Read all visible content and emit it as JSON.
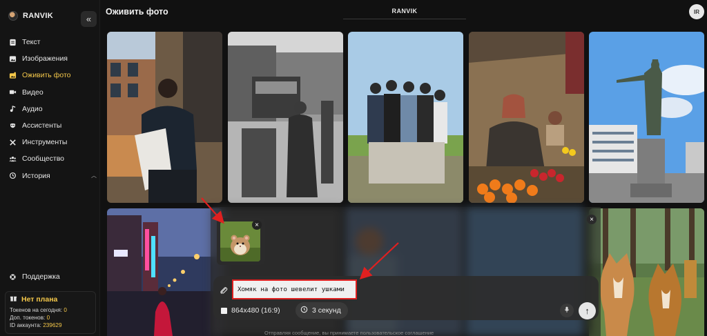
{
  "brand": {
    "name": "RANVIK",
    "collapse_icon": "double-chevron-left-icon"
  },
  "header": {
    "title": "Оживить фото",
    "center_label": "RANVIK",
    "avatar_initials": "IR"
  },
  "sidebar": {
    "items": [
      {
        "label": "Текст",
        "icon": "document-icon",
        "active": false
      },
      {
        "label": "Изображения",
        "icon": "image-icon",
        "active": false
      },
      {
        "label": "Оживить фото",
        "icon": "animate-photo-icon",
        "active": true
      },
      {
        "label": "Видео",
        "icon": "video-camera-icon",
        "active": false
      },
      {
        "label": "Аудио",
        "icon": "music-note-icon",
        "active": false
      },
      {
        "label": "Ассистенты",
        "icon": "mask-icon",
        "active": false
      },
      {
        "label": "Инструменты",
        "icon": "tools-icon",
        "active": false
      },
      {
        "label": "Сообщество",
        "icon": "people-icon",
        "active": false
      },
      {
        "label": "История",
        "icon": "history-icon",
        "active": false,
        "expandable": true
      }
    ],
    "support_label": "Поддержка",
    "plan": {
      "title": "Нет плана",
      "tokens_today_label": "Токенов на сегодня: ",
      "tokens_today_value": "0",
      "extra_tokens_label": "Доп. токенов: ",
      "extra_tokens_value": "0",
      "account_id_label": "ID аккаунта: ",
      "account_id_value": "239629"
    }
  },
  "prompt": {
    "text": "Хомяк на фото шевелит ушками",
    "resolution": "864x480 (16:9)",
    "duration": "3 секунд",
    "footnote": "Отправляя сообщение, вы принимаете пользовательское соглашение"
  },
  "colors": {
    "accent": "#f5c84a",
    "highlight": "#e02020",
    "background": "#111111"
  }
}
